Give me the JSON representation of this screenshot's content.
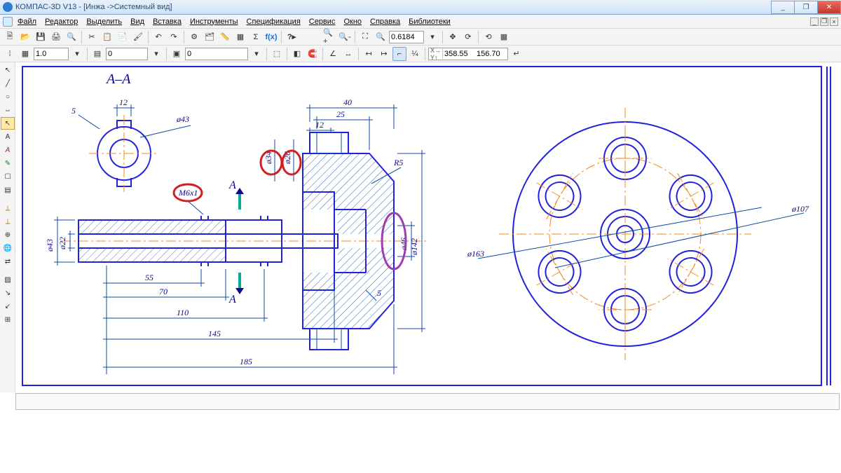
{
  "window": {
    "title": "КОМПАС-3D V13 - [Инжа ->Системный вид]",
    "min": "_",
    "max": "❐",
    "close": "✕"
  },
  "menu": {
    "file": "Файл",
    "edit": "Редактор",
    "select": "Выделить",
    "view": "Вид",
    "insert": "Вставка",
    "tools": "Инструменты",
    "spec": "Спецификация",
    "service": "Сервис",
    "window": "Окно",
    "help": "Справка",
    "lib": "Библиотеки"
  },
  "toolbar1": {
    "zoom_value": "0.6184"
  },
  "toolbar2": {
    "step": "1.0",
    "layer": "0",
    "view": "0",
    "coord_x": "358.55",
    "coord_y": "156.70"
  },
  "drawing": {
    "section_label": "А–А",
    "cut_label_top": "А",
    "cut_label_bot": "А",
    "dims": {
      "d5": "5",
      "d12a": "12",
      "d43": "ø43",
      "d40": "40",
      "d25": "25",
      "d12b": "12",
      "d34": "ø34",
      "d26": "ø26",
      "m6": "М6х1",
      "r5": "R5",
      "d46": "ø46",
      "d142": "ø142",
      "d43b": "ø43",
      "d22": "ø22",
      "d55": "55",
      "d70": "70",
      "d110": "110",
      "d145": "145",
      "d185": "185",
      "d5b": "5",
      "d163": "ø163",
      "d107": "ø107"
    }
  }
}
